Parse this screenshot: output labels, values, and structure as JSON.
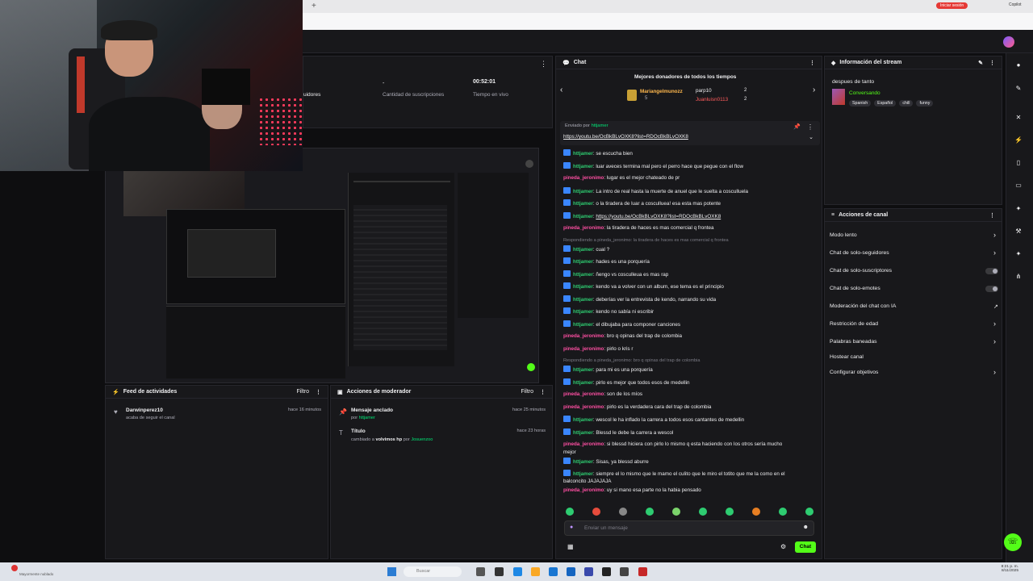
{
  "browser": {
    "new_tab": "+",
    "pill_label": "Iniciar sesión",
    "copilot": "Copilot"
  },
  "stats": {
    "followers_label": "uidores",
    "subs_value": "-",
    "subs_label": "Cantidad de suscripciones",
    "live_time": "00:52:01",
    "live_label": "Tiempo en vivo"
  },
  "activity": {
    "title": "Feed de actividades",
    "filter": "Filtro",
    "items": [
      {
        "user": "Darwinperez10",
        "text": "acaba de seguir el canal",
        "time": "hace 16 minutos"
      }
    ]
  },
  "mod_actions": {
    "title": "Acciones de moderador",
    "filter": "Filtro",
    "items": [
      {
        "title": "Mensaje anclado",
        "by": "por",
        "user": "httjamer",
        "time": "hace 25 minutos"
      },
      {
        "title": "Título",
        "desc": "cambiado a",
        "value": "volvimos hp",
        "by": "por",
        "user": "Josuenzoo",
        "time": "hace 23 horas"
      }
    ]
  },
  "chat": {
    "title": "Chat",
    "donors_title": "Mejores donadores de todos los tiempos",
    "donors": [
      {
        "name": "Mariangelmunozz",
        "count": "5"
      },
      {
        "name": "parp10",
        "count": "2"
      },
      {
        "name": "Juanluisn0113",
        "count": "2"
      }
    ],
    "pinned_by_label": "Enviado por",
    "pinned_user": "httjamer",
    "pinned_link": "https://youtu.be/OcBkBLvOXK8?list=RDOcBkBLvOXK8",
    "lines": [
      {
        "u": "httjamer",
        "t": "se escucha bien",
        "b": true
      },
      {
        "u": "httjamer",
        "t": "luar aveces termina mal pero el perro hace que pegue con el flow",
        "b": true
      },
      {
        "u": "pineda_jeronimo",
        "t": "lugar es el mejor chateado de pr",
        "b": false
      },
      {
        "u": "httjamer",
        "t": "La intro de real hasta la muerte de anuel que le suelta a cosculluela",
        "b": true
      },
      {
        "u": "httjamer",
        "t": "o la tiradera de luar a cosculluea! esa esta mas potente",
        "b": true
      },
      {
        "u": "httjamer",
        "t": "https://youtu.be/OcBkBLvOXK8?list=RDOcBkBLvOXK8",
        "b": true
      },
      {
        "u": "pineda_jeronimo",
        "t": "la tiradera de haces es mas comercial q frontea",
        "b": false
      },
      {
        "reply": "Respondiendo a pineda_jeronimo: la tiradera de haces es mas comercial q frontea"
      },
      {
        "u": "httjamer",
        "t": "cual ?",
        "b": true
      },
      {
        "u": "httjamer",
        "t": "hades es una porquería",
        "b": true
      },
      {
        "u": "httjamer",
        "t": "ñengo vs cosculleua es mas rap",
        "b": true
      },
      {
        "u": "httjamer",
        "t": "kendo va a volver con un album, ese tema es el principio",
        "b": true
      },
      {
        "u": "httjamer",
        "t": "deberías ver la entrevista de kendo, narrando su vida",
        "b": true
      },
      {
        "u": "httjamer",
        "t": "kendo no sabía ni escribir",
        "b": true
      },
      {
        "u": "httjamer",
        "t": "el dibujaba para componer canciones",
        "b": true
      },
      {
        "u": "pineda_jeronimo",
        "t": "bro q opinas del trap de colombia",
        "b": false
      },
      {
        "u": "pineda_jeronimo",
        "t": "pirlo o kris r",
        "b": false
      },
      {
        "reply": "Respondiendo a pineda_jeronimo: bro q opinas del trap de colombia"
      },
      {
        "u": "httjamer",
        "t": "para mi es una porquería",
        "b": true
      },
      {
        "u": "httjamer",
        "t": "pirlo es mejor que todos esos de medellin",
        "b": true
      },
      {
        "u": "pineda_jeronimo",
        "t": "son de los míos",
        "b": false
      },
      {
        "u": "pineda_jeronimo",
        "t": "pirlo es la verdadera cara del trap de colombia",
        "b": false
      },
      {
        "u": "httjamer",
        "t": "wescol le ha inflado la carrera a todos esos cantantes de medellin",
        "b": true
      },
      {
        "u": "httjamer",
        "t": "Blessd le debe la carrera a wescol",
        "b": true
      },
      {
        "u": "pineda_jeronimo",
        "t": "si blessd hiciera con pirlo lo mismo q esta haciendo con los otros sería mucho",
        "b": false,
        "cont": "mejor"
      },
      {
        "u": "httjamer",
        "t": "Sisas, ya blessd aburre",
        "b": true
      },
      {
        "u": "httjamer",
        "t": "siempre el lo mismo que le mamo el culito que le miro el totito que me la como en el",
        "b": true,
        "cont": "balconcito JAJAJAJA"
      },
      {
        "u": "pineda_jeronimo",
        "t": "uy si mano esa parte no la habia pensado",
        "b": false
      }
    ],
    "input_placeholder": "Enviar un mensaje",
    "send_label": "Chat"
  },
  "stream_info": {
    "title": "Información del stream",
    "stream_title": "despues de tanto",
    "category": "Conversando",
    "tags": [
      "Spanish",
      "Español",
      "chill",
      "funny"
    ]
  },
  "channel_actions": {
    "title": "Acciones de canal",
    "items": [
      {
        "label": "Modo lento",
        "ctl": "chevron"
      },
      {
        "label": "Chat de solo-seguidores",
        "ctl": "chevron"
      },
      {
        "label": "Chat de solo-suscriptores",
        "ctl": "toggle"
      },
      {
        "label": "Chat de solo-emotes",
        "ctl": "toggle"
      },
      {
        "label": "Moderación del chat con IA",
        "ctl": "external"
      },
      {
        "label": "Restricción de edad",
        "ctl": "chevron"
      },
      {
        "label": "Palabras baneadas",
        "ctl": "chevron"
      },
      {
        "label": "Hostear canal",
        "ctl": "none"
      },
      {
        "label": "Configurar objetivos",
        "ctl": "chevron"
      }
    ]
  },
  "taskbar": {
    "search_placeholder": "Buscar",
    "status_text": "Mayormente nublado",
    "clock_time": "8:21 p. m.",
    "clock_date": "8/11/2025"
  },
  "colors": {
    "accent_green": "#53fc18",
    "panel_bg": "#18181b",
    "page_bg": "#0e0e10"
  }
}
